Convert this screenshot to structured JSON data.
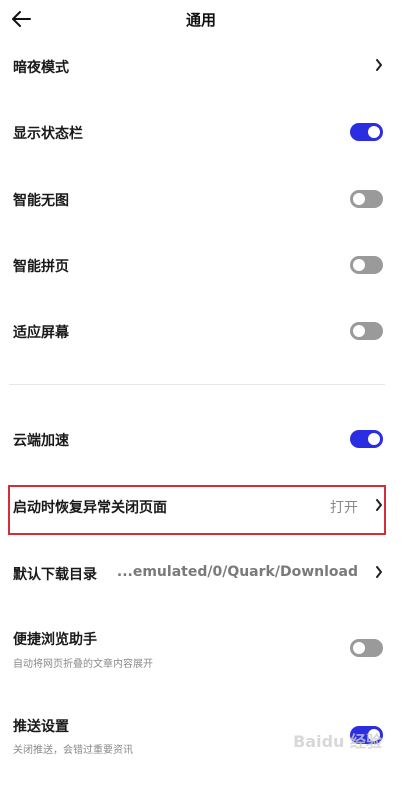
{
  "header": {
    "title": "通用"
  },
  "items": {
    "dark_mode": {
      "label": "暗夜模式"
    },
    "status_bar": {
      "label": "显示状态栏",
      "state": "on"
    },
    "smart_no_image": {
      "label": "智能无图",
      "state": "off"
    },
    "smart_page_join": {
      "label": "智能拼页",
      "state": "off"
    },
    "fit_screen": {
      "label": "适应屏幕",
      "state": "off"
    },
    "cloud_accel": {
      "label": "云端加速",
      "state": "on"
    },
    "restore_pages": {
      "label": "启动时恢复异常关闭页面",
      "value": "打开"
    },
    "download_dir": {
      "label": "默认下载目录",
      "value": "...emulated/0/Quark/Download"
    },
    "browse_assistant": {
      "label": "便捷浏览助手",
      "desc": "自动将网页折叠的文章内容展开",
      "state": "off"
    },
    "push_settings": {
      "label": "推送设置",
      "desc": "关闭推送，会错过重要资讯",
      "state": "on"
    }
  },
  "watermark": "Baidu 经验",
  "colors": {
    "toggle_on": "#2b2ee0",
    "toggle_off": "#9a9a9a",
    "highlight": "#d32f3a"
  }
}
